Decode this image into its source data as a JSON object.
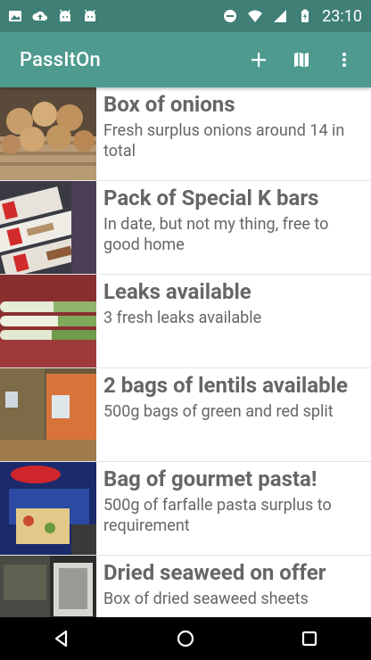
{
  "status_bar": {
    "time": "23:10",
    "left_icons": [
      "image-icon",
      "cloud-upload-icon",
      "android-icon",
      "android-icon"
    ],
    "right_icons": [
      "do-not-disturb-icon",
      "wifi-icon",
      "signal-icon",
      "battery-charging-icon"
    ]
  },
  "app_bar": {
    "title": "PassItOn",
    "actions": [
      "add-icon",
      "map-icon",
      "more-vert-icon"
    ]
  },
  "items": [
    {
      "title": "Box of onions",
      "desc": "Fresh surplus onions around 14 in total"
    },
    {
      "title": "Pack of Special K bars",
      "desc": "In date, but not my thing, free to good home"
    },
    {
      "title": "Leaks available",
      "desc": "3 fresh leaks available"
    },
    {
      "title": "2 bags of lentils available",
      "desc": "500g bags of green and red split"
    },
    {
      "title": "Bag of gourmet pasta!",
      "desc": "500g of farfalle pasta surplus to requirement"
    },
    {
      "title": "Dried seaweed on offer",
      "desc": "Box of dried seaweed sheets"
    }
  ],
  "colors": {
    "status_bar": "#3f7f76",
    "app_bar": "#4e9a8e",
    "text": "#666666"
  },
  "nav": [
    "back-icon",
    "home-icon",
    "recents-icon"
  ]
}
